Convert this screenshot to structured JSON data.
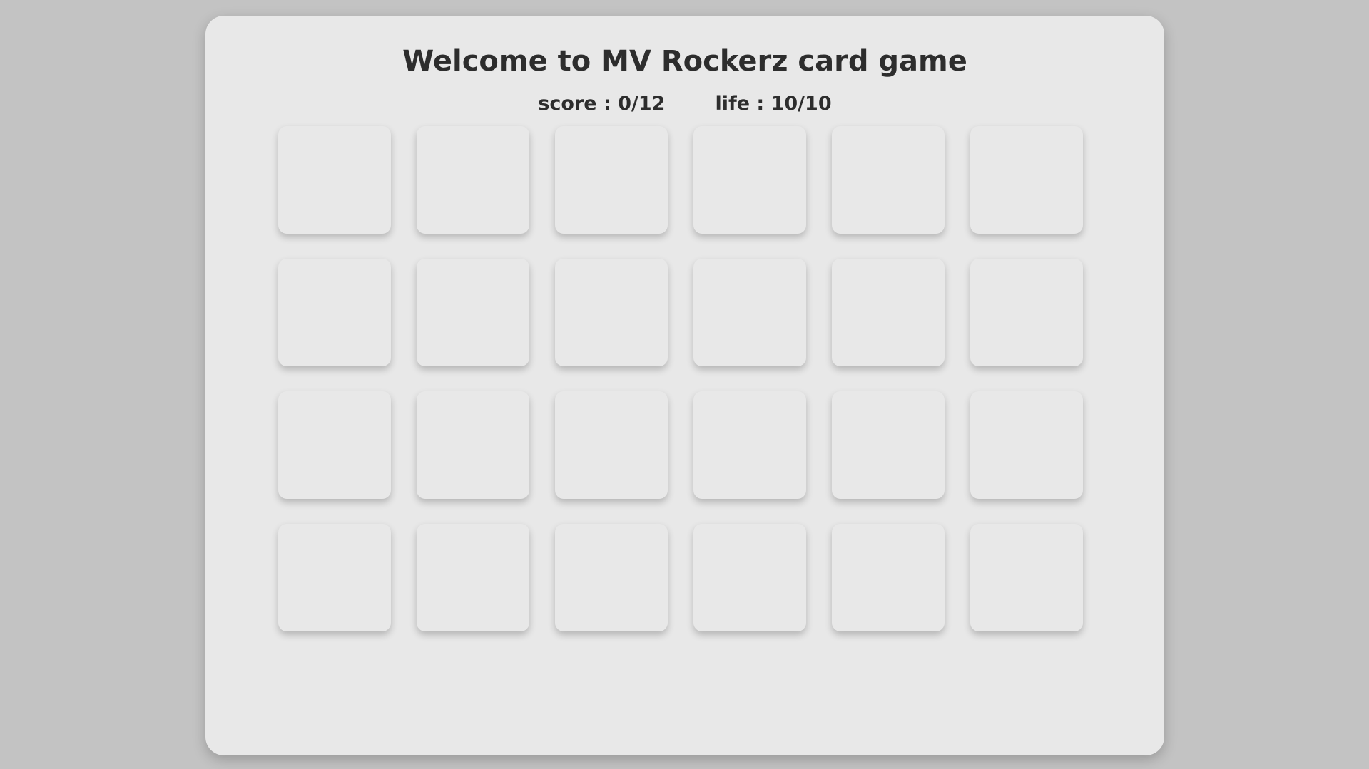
{
  "game": {
    "title": "Welcome to MV Rockerz card game",
    "score_text": "score : 0/12",
    "life_text": "life : 10/10",
    "score": 0,
    "score_max": 12,
    "life": 10,
    "life_max": 10
  },
  "board": {
    "rows": 4,
    "columns": 6,
    "cards_face_down": 24
  },
  "colors": {
    "background": "#c3c3c3",
    "panel": "#e8e8e8",
    "card": "#e8e8e8",
    "text": "#2d2d2d"
  }
}
